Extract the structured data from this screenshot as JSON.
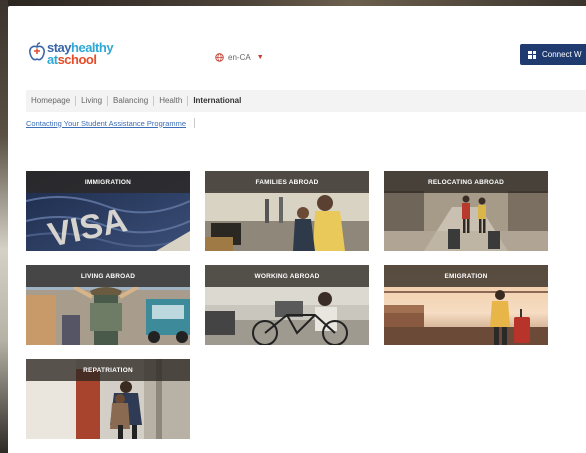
{
  "header": {
    "logo": {
      "line1_a": "stay",
      "line1_b": "healthy",
      "line2_a": "at",
      "line2_b": "school"
    },
    "language": "en-CA",
    "connect_label": "Connect W"
  },
  "nav": {
    "items": [
      {
        "label": "Homepage"
      },
      {
        "label": "Living"
      },
      {
        "label": "Balancing"
      },
      {
        "label": "Health"
      },
      {
        "label": "International",
        "active": true
      }
    ]
  },
  "subnav": {
    "link": "Contacting Your Student Assistance Programme"
  },
  "tiles": [
    {
      "label": "IMMIGRATION",
      "icon": "visa-photo"
    },
    {
      "label": "FAMILIES ABROAD",
      "icon": "family-photo"
    },
    {
      "label": "RELOCATING ABROAD",
      "icon": "luggage-photo"
    },
    {
      "label": "LIVING ABROAD",
      "icon": "travellers-photo"
    },
    {
      "label": "WORKING ABROAD",
      "icon": "bicycle-photo"
    },
    {
      "label": "EMIGRATION",
      "icon": "airport-photo"
    },
    {
      "label": "REPATRIATION",
      "icon": "hug-photo"
    }
  ],
  "colors": {
    "brand_navy": "#1f3a6e",
    "link_blue": "#3c6fb5",
    "logo_blue": "#3a66a8",
    "logo_cyan": "#2fa8d6",
    "logo_orange": "#e64d2a"
  }
}
